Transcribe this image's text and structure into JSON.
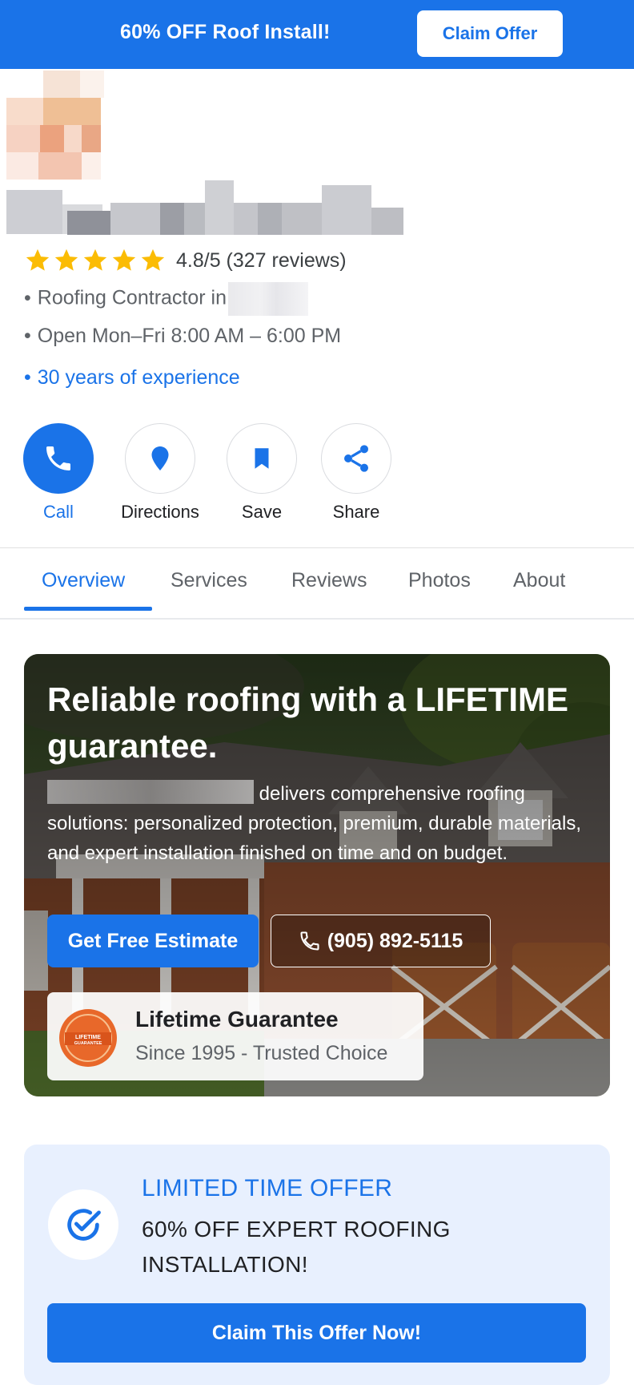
{
  "promo": {
    "text": "60% OFF Roof Install!",
    "button": "Claim Offer"
  },
  "business": {
    "rating_text": "4.8/5 (327 reviews)",
    "rating_stars": 5,
    "category_prefix": "Roofing Contractor in",
    "hours": "Open Mon–Fri 8:00 AM – 6:00 PM",
    "experience": "30 years of experience"
  },
  "actions": [
    {
      "label": "Call",
      "icon": "phone-icon"
    },
    {
      "label": "Directions",
      "icon": "location-pin-icon"
    },
    {
      "label": "Save",
      "icon": "bookmark-icon"
    },
    {
      "label": "Share",
      "icon": "share-icon"
    }
  ],
  "tabs": [
    "Overview",
    "Services",
    "Reviews",
    "Photos",
    "About"
  ],
  "active_tab": "Overview",
  "hero": {
    "title": "Reliable roofing with a LIFETIME guarantee.",
    "description": "delivers comprehensive roofing solutions: personalized protection, premium, durable materials, and expert installation finished on time and on budget.",
    "estimate_button": "Get Free Estimate",
    "phone": "(905) 892-5115",
    "badge_title": "Lifetime Guarantee",
    "badge_subtitle": "Since 1995 - Trusted Choice",
    "seal_text": "LIFETIME GUARANTEE"
  },
  "offer": {
    "heading": "LIMITED TIME OFFER",
    "text": "60% OFF EXPERT ROOFING INSTALLATION!",
    "button": "Claim This Offer Now!"
  },
  "colors": {
    "brand": "#1a73e8",
    "star": "#fbbc04",
    "offer_bg": "#e8f0fe"
  }
}
